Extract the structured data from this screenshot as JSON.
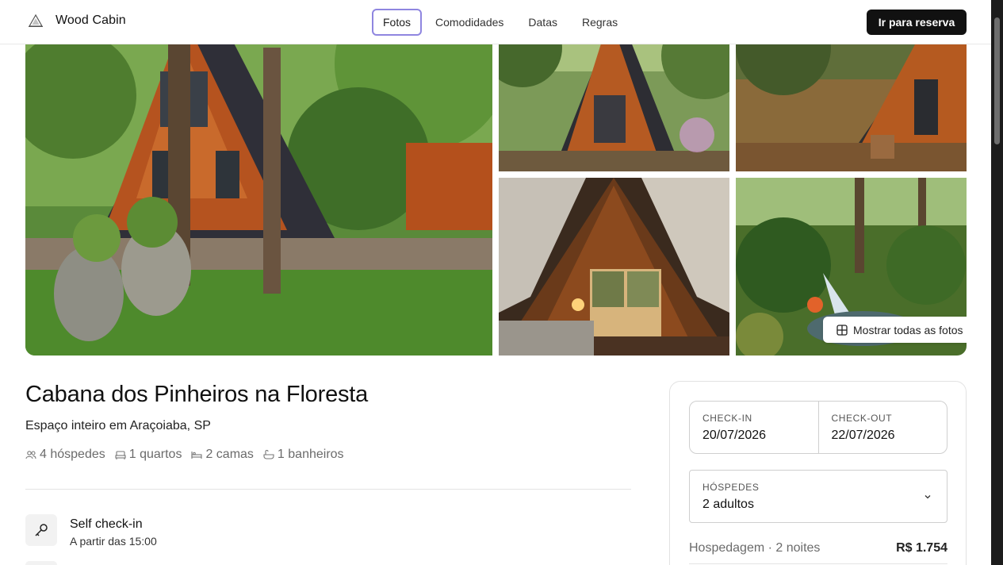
{
  "header": {
    "brand_name": "Wood Cabin",
    "nav": [
      {
        "label": "Fotos",
        "active": true
      },
      {
        "label": "Comodidades",
        "active": false
      },
      {
        "label": "Datas",
        "active": false
      },
      {
        "label": "Regras",
        "active": false
      }
    ],
    "cta_label": "Ir para reserva"
  },
  "gallery": {
    "show_all_label": "Mostrar todas as fotos"
  },
  "listing": {
    "title": "Cabana dos Pinheiros na Floresta",
    "subtitle": "Espaço inteiro em Araçoiaba, SP",
    "stats": [
      {
        "icon": "guests-icon",
        "label": "4 hóspedes"
      },
      {
        "icon": "bedroom-icon",
        "label": "1 quartos"
      },
      {
        "icon": "bed-icon",
        "label": "2 camas"
      },
      {
        "icon": "bath-icon",
        "label": "1 banheiros"
      }
    ],
    "features": [
      {
        "icon": "key-icon",
        "title": "Self check-in",
        "subtitle": "A partir das 15:00"
      }
    ]
  },
  "booking": {
    "checkin_label": "CHECK-IN",
    "checkin_value": "20/07/2026",
    "checkout_label": "CHECK-OUT",
    "checkout_value": "22/07/2026",
    "guests_label": "HÓSPEDES",
    "guests_value": "2 adultos",
    "price_label": "Hospedagem · 2 noites",
    "price_value": "R$ 1.754"
  },
  "colors": {
    "accent_outline": "#8f86e0",
    "cta_bg": "#111111",
    "muted_text": "#6b6b6b"
  }
}
